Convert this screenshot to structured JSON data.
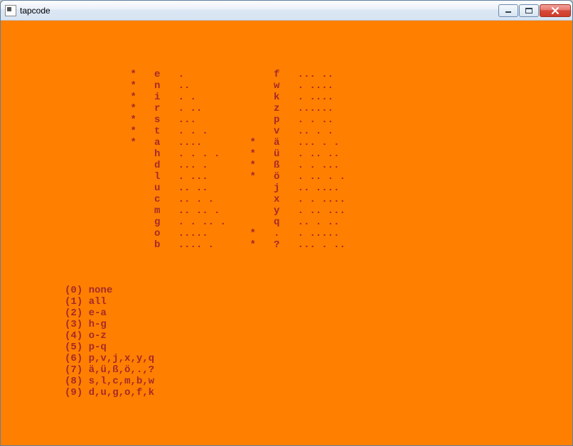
{
  "window": {
    "title": "tapcode"
  },
  "table": {
    "indent": "                     ",
    "col1_star_pad": 4,
    "col1_letter_pad": 4,
    "col1_code_pad": 12,
    "col2_star_pad": 4,
    "col2_letter_pad": 4,
    "rows": [
      [
        "*",
        "e",
        ".",
        " ",
        "f",
        "... .."
      ],
      [
        "*",
        "n",
        "..",
        " ",
        "w",
        ". ...."
      ],
      [
        "*",
        "i",
        ". .",
        " ",
        "k",
        ". ...."
      ],
      [
        "*",
        "r",
        ". ..",
        " ",
        "z",
        "......"
      ],
      [
        "*",
        "s",
        "...",
        " ",
        "p",
        ". . .."
      ],
      [
        "*",
        "t",
        ". . .",
        " ",
        "v",
        ".. . ."
      ],
      [
        "*",
        "a",
        "....",
        "*",
        "ä",
        "... . ."
      ],
      [
        " ",
        "h",
        ". . . .",
        "*",
        "ü",
        ". .. .."
      ],
      [
        " ",
        "d",
        "... .",
        "*",
        "ß",
        ". . ..."
      ],
      [
        " ",
        "l",
        ". ...",
        "*",
        "ö",
        ". .. . ."
      ],
      [
        " ",
        "u",
        ".. ..",
        " ",
        "j",
        ".. ...."
      ],
      [
        " ",
        "c",
        ".. . .",
        " ",
        "x",
        ". . ...."
      ],
      [
        " ",
        "m",
        ".. .. .",
        " ",
        "y",
        ". .. ..."
      ],
      [
        " ",
        "g",
        ". . .. .",
        " ",
        "q",
        ".. . .."
      ],
      [
        " ",
        "o",
        ".....",
        "*",
        ".",
        ". ....."
      ],
      [
        " ",
        "b",
        ".... .",
        "*",
        "?",
        "... . .."
      ]
    ]
  },
  "menu": {
    "indent": "          ",
    "items": [
      "(0) none",
      "(1) all",
      "(2) e-a",
      "(3) h-g",
      "(4) o-z",
      "(5) p-q",
      "(6) p,v,j,x,y,q",
      "(7) ä,ü,ß,ö,.,?",
      "(8) s,l,c,m,b,w",
      "(9) d,u,g,o,f,k"
    ]
  },
  "blank_rows_before_table": 4,
  "blank_rows_between": 3
}
